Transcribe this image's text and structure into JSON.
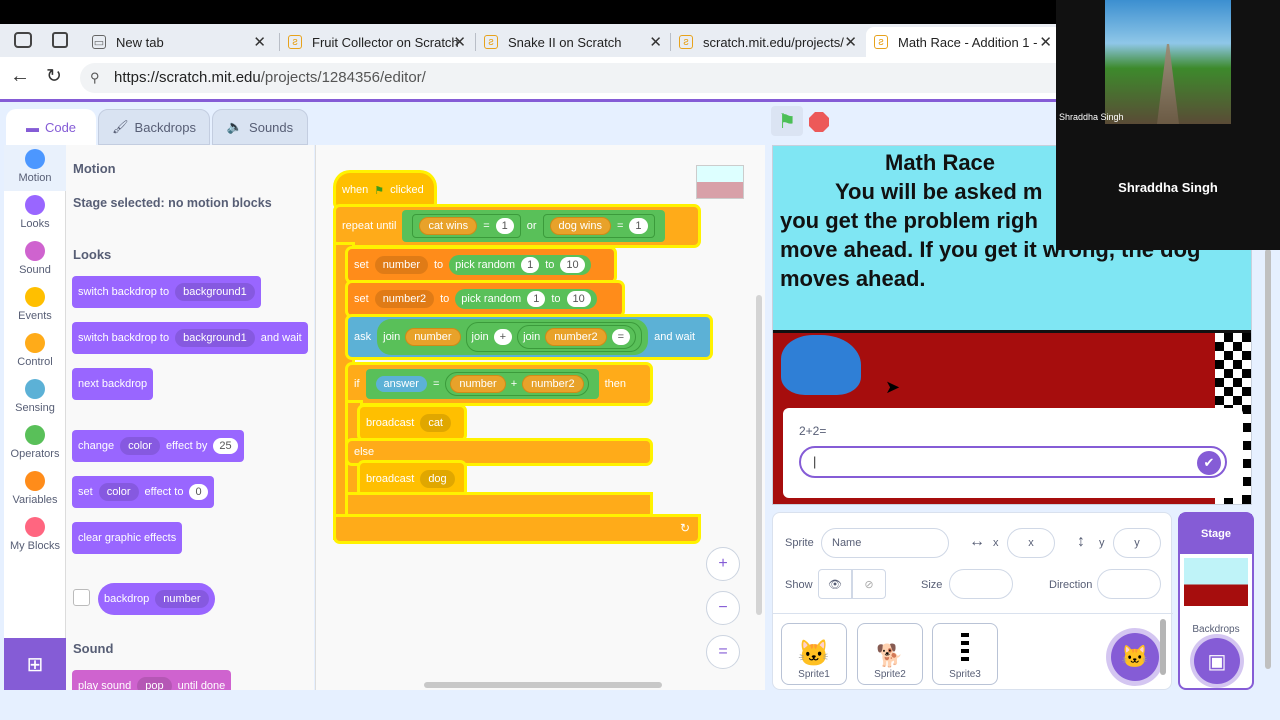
{
  "browser": {
    "tabs": [
      {
        "label": "New tab"
      },
      {
        "label": "Fruit Collector on Scratch"
      },
      {
        "label": "Snake II on Scratch"
      },
      {
        "label": "scratch.mit.edu/projects/"
      },
      {
        "label": "Math Race - Addition 1 -"
      }
    ],
    "url_host": "https://scratch.mit.edu",
    "url_path": "/projects/1284356/editor/"
  },
  "editor": {
    "tabs": {
      "code": "Code",
      "backdrops": "Backdrops",
      "sounds": "Sounds"
    },
    "categories": [
      {
        "label": "Motion",
        "color": "#4c97ff"
      },
      {
        "label": "Looks",
        "color": "#9966ff"
      },
      {
        "label": "Sound",
        "color": "#cf63cf"
      },
      {
        "label": "Events",
        "color": "#ffbf00"
      },
      {
        "label": "Control",
        "color": "#ffab19"
      },
      {
        "label": "Sensing",
        "color": "#5cb1d6"
      },
      {
        "label": "Operators",
        "color": "#59c059"
      },
      {
        "label": "Variables",
        "color": "#ff8c1a"
      },
      {
        "label": "My Blocks",
        "color": "#ff6680"
      }
    ],
    "palette": {
      "motion_heading": "Motion",
      "motion_note": "Stage selected: no motion blocks",
      "looks_heading": "Looks",
      "switch_backdrop": "switch backdrop to",
      "backdrop_value": "background1",
      "and_wait": "and wait",
      "next_backdrop": "next backdrop",
      "change": "change",
      "effect_color": "color",
      "effect_by": "effect by",
      "effect_by_value": "25",
      "set": "set",
      "effect_to": "effect to",
      "effect_to_value": "0",
      "clear_effects": "clear graphic effects",
      "backdrop": "backdrop",
      "backdrop_number": "number",
      "sound_heading": "Sound",
      "play_sound": "play sound",
      "sound_value": "pop",
      "until_done": "until done"
    },
    "script": {
      "when": "when",
      "clicked": "clicked",
      "repeat_until": "repeat until",
      "cat_wins": "cat wins",
      "eq": "=",
      "one": "1",
      "or": "or",
      "dog_wins": "dog wins",
      "set": "set",
      "number": "number",
      "to": "to",
      "pick_random": "pick random",
      "ten": "10",
      "number2": "number2",
      "ask": "ask",
      "join": "join",
      "plus": "+",
      "and_wait": "and wait",
      "if": "if",
      "answer": "answer",
      "then": "then",
      "broadcast": "broadcast",
      "cat": "cat",
      "else": "else",
      "dog": "dog"
    }
  },
  "stage": {
    "title": "Math Race",
    "line1": "You will be asked m",
    "line2": "you get the problem righ",
    "line3": "move ahead. If you get it wrong, the dog",
    "line4": "moves ahead.",
    "question": "2+2=",
    "answer_value": "|"
  },
  "sprite_info": {
    "sprite_label": "Sprite",
    "name_placeholder": "Name",
    "x_label": "x",
    "x_placeholder": "x",
    "y_label": "y",
    "y_placeholder": "y",
    "show_label": "Show",
    "size_label": "Size",
    "direction_label": "Direction",
    "sprites": [
      {
        "name": "Sprite1"
      },
      {
        "name": "Sprite2"
      },
      {
        "name": "Sprite3"
      }
    ]
  },
  "stage_pane": {
    "label": "Stage",
    "backdrops_label": "Backdrops"
  },
  "webcam": {
    "caption": "Shraddha Singh",
    "name": "Shraddha Singh"
  }
}
